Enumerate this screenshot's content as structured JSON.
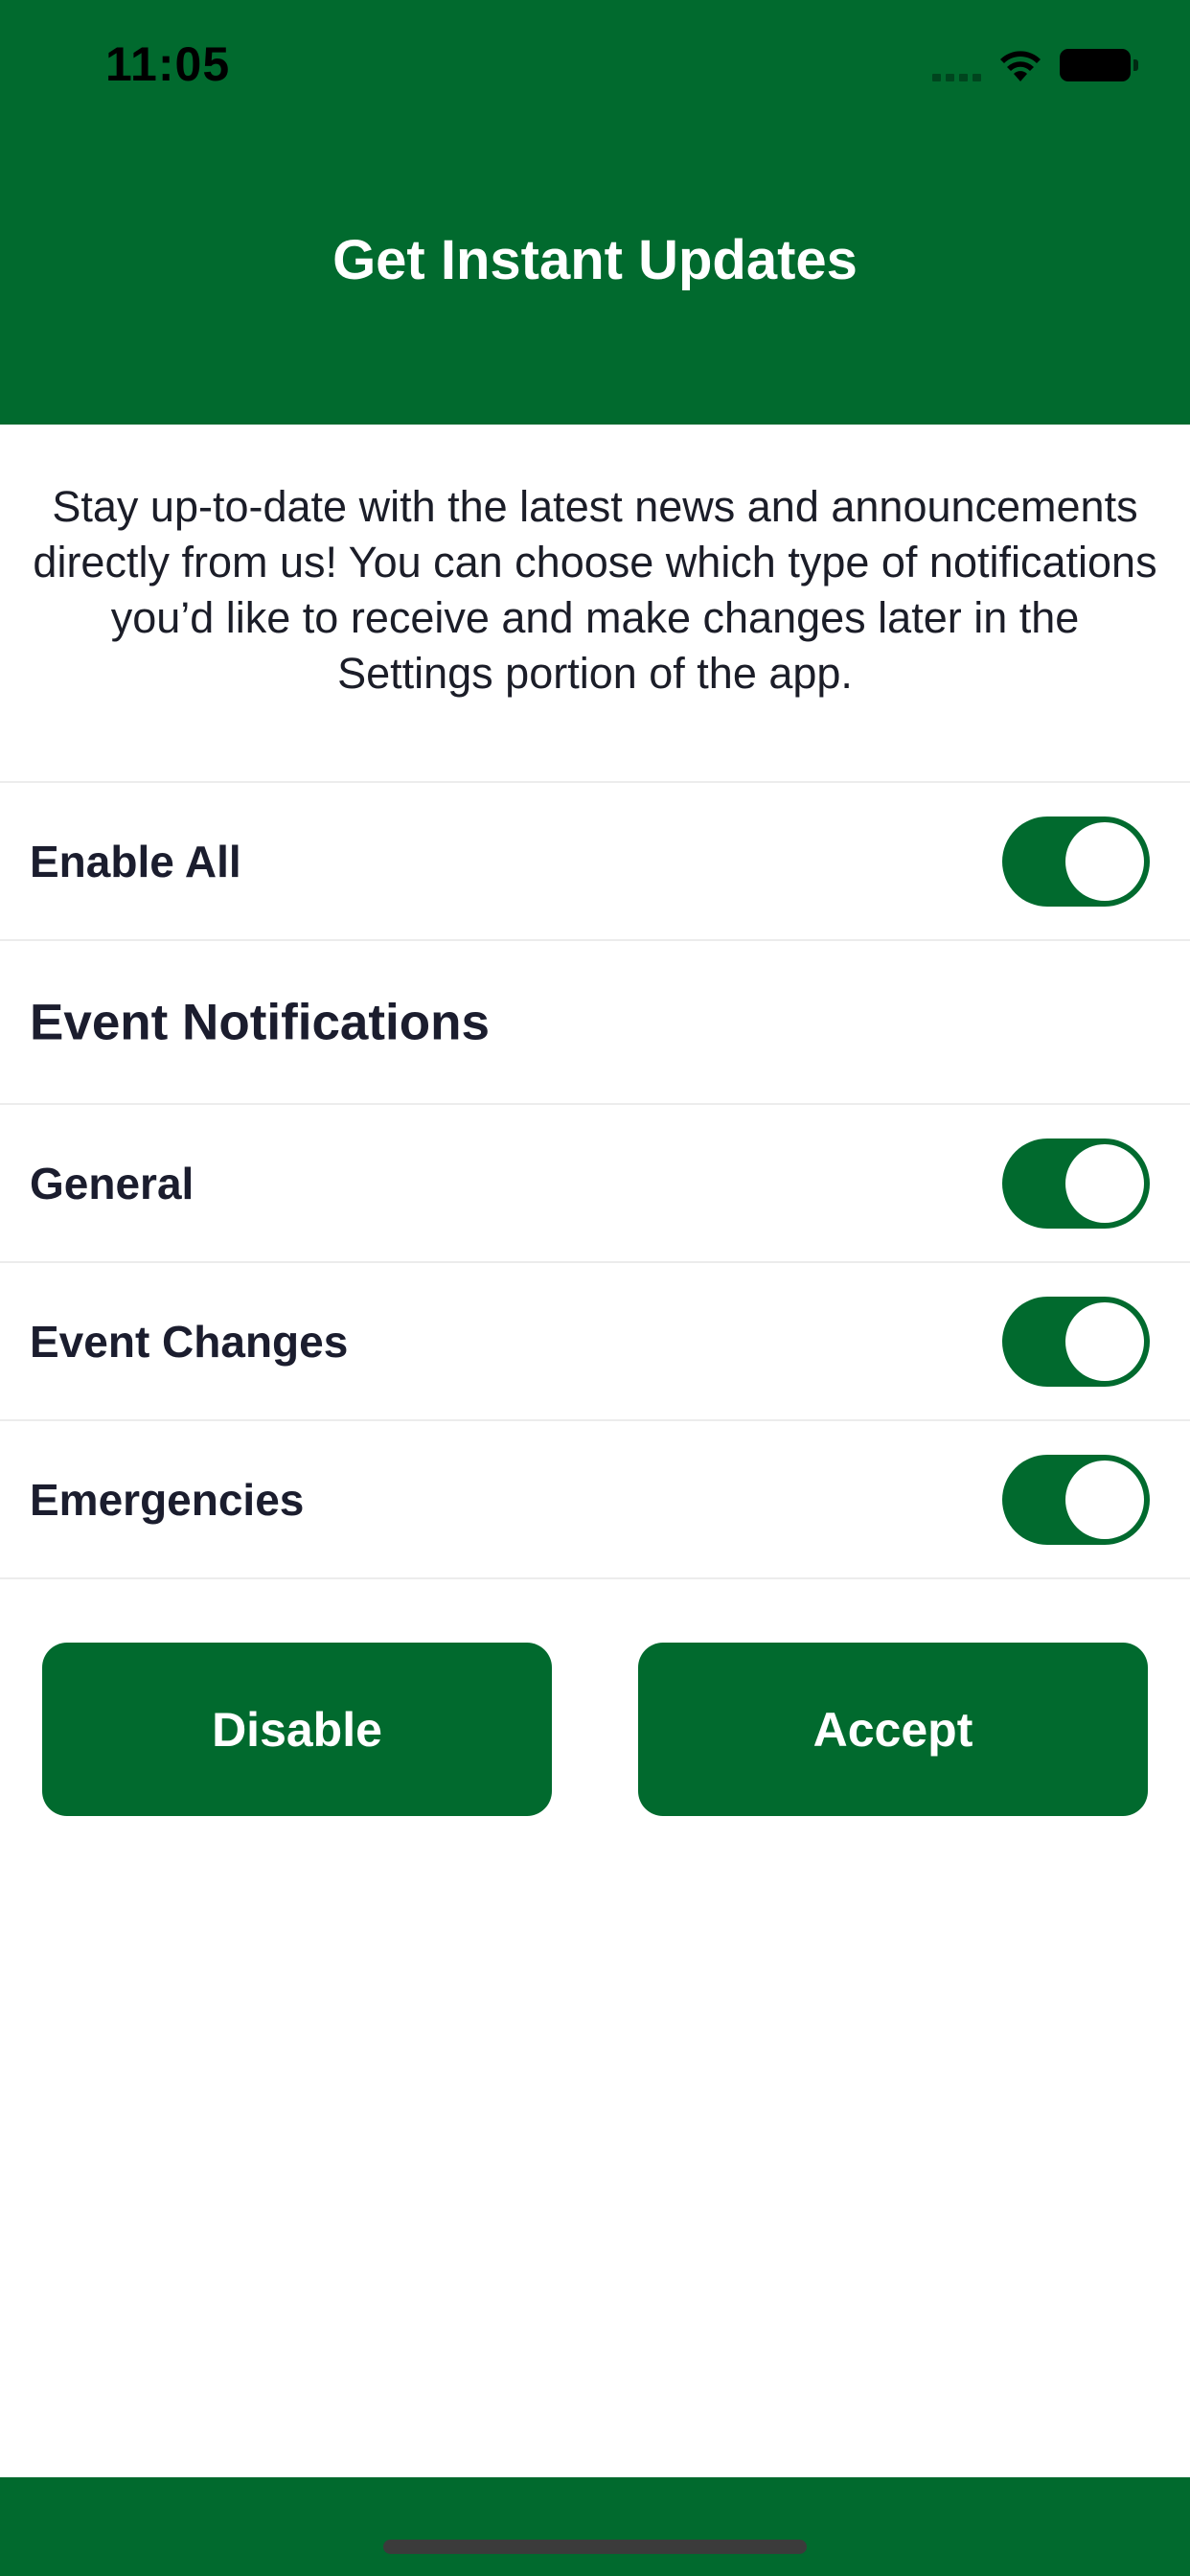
{
  "status_bar": {
    "time": "11:05"
  },
  "header": {
    "title": "Get Instant Updates"
  },
  "intro": {
    "text": "Stay up-to-date with the latest news and announcements directly from us! You can choose which type of notifications you’d like to receive and make changes later in the Settings portion of the app."
  },
  "settings": {
    "enable_all": {
      "label": "Enable All",
      "on": true
    },
    "section_title": "Event Notifications",
    "items": [
      {
        "label": "General",
        "on": true
      },
      {
        "label": "Event Changes",
        "on": true
      },
      {
        "label": "Emergencies",
        "on": true
      }
    ]
  },
  "actions": {
    "disable_label": "Disable",
    "accept_label": "Accept"
  },
  "colors": {
    "brand_green": "#016a2e",
    "text_dark": "#1b1d2e",
    "divider": "#ececec"
  },
  "icons": [
    "cellular-signal-icon",
    "wifi-icon",
    "battery-icon",
    "home-indicator"
  ]
}
